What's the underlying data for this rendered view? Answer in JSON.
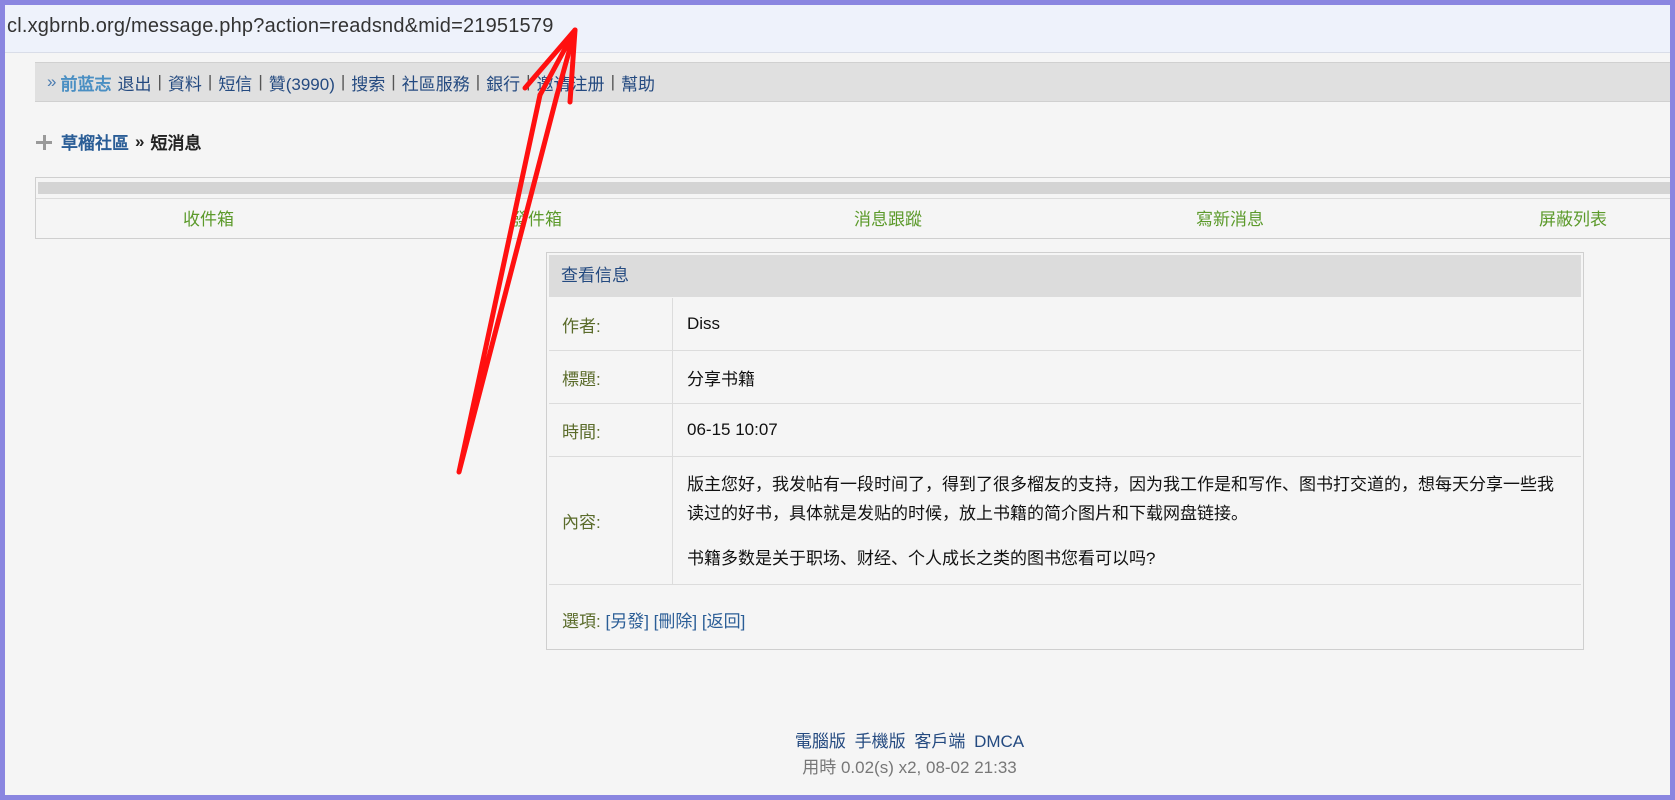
{
  "browser": {
    "url": "cl.xgbrnb.org/message.php?action=readsnd&mid=21951579"
  },
  "topnav": {
    "prefix": "»",
    "username": "前蓝志",
    "items": [
      "退出",
      "資料",
      "短信",
      "贊(3990)",
      "搜索",
      "社區服務",
      "銀行",
      "邀请注册",
      "幫助"
    ],
    "separator": "|"
  },
  "breadcrumb": {
    "home": "草榴社區",
    "separator": "»",
    "current": "短消息"
  },
  "tabs": [
    "收件箱",
    "發件箱",
    "消息跟蹤",
    "寫新消息",
    "屏蔽列表"
  ],
  "message": {
    "header": "查看信息",
    "author_label": "作者:",
    "author": "Diss",
    "title_label": "標題:",
    "title": "分享书籍",
    "time_label": "時間:",
    "time": "06-15 10:07",
    "content_label": "內容:",
    "content_p1": "版主您好，我发帖有一段时间了，得到了很多榴友的支持，因为我工作是和写作、图书打交道的，想每天分享一些我读过的好书，具体就是发贴的时候，放上书籍的简介图片和下载网盘链接。",
    "content_p2": "书籍多数是关于职场、财经、个人成长之类的图书您看可以吗?",
    "options_label": "選項:",
    "options": [
      "[另發]",
      "[刪除]",
      "[返回]"
    ]
  },
  "footer": {
    "links": [
      "電腦版",
      "手機版",
      "客戶端",
      "DMCA"
    ],
    "time": "用時 0.02(s) x2, 08-02 21:33"
  },
  "colors": {
    "annotation_arrow": "#ff1010",
    "frame_border": "#8a86e0",
    "tab_text": "#5c9a2b",
    "link_blue": "#244a80"
  }
}
